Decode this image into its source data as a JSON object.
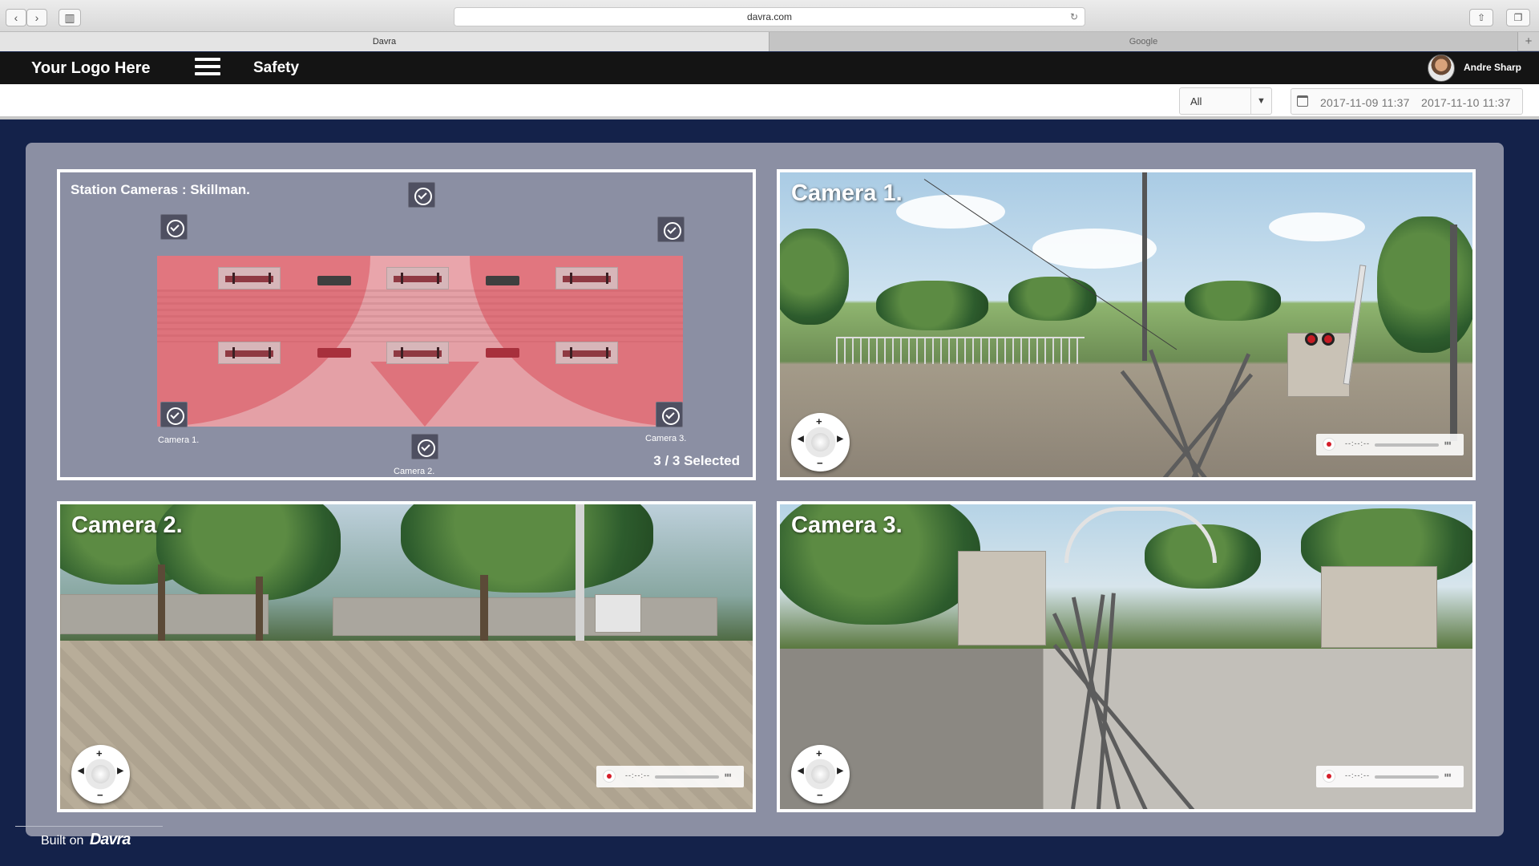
{
  "browser": {
    "url": "davra.com",
    "tabs": [
      {
        "label": "Davra",
        "active": true
      },
      {
        "label": "Google",
        "active": false
      }
    ],
    "back_icon": "chevron-left-icon",
    "forward_icon": "chevron-right-icon",
    "sidebar_icon": "sidebar-icon",
    "reload_icon": "reload-icon",
    "share_icon": "share-icon",
    "window_icon": "window-icon",
    "new_tab_icon": "plus-icon"
  },
  "header": {
    "logo": "Your Logo Here",
    "menu_icon": "hamburger-icon",
    "title": "Safety",
    "user_name": "Andre Sharp",
    "avatar_icon": "user-avatar-icon"
  },
  "filters": {
    "select_value": "All",
    "date_icon": "calendar-icon",
    "date_from": "2017-11-09  11:37",
    "date_to": "2017-11-10  11:37"
  },
  "station": {
    "title": "Station Cameras :  Skillman.",
    "selected": "3 / 3 Selected",
    "cameras": [
      {
        "label": "Camera 1."
      },
      {
        "label": "Camera 2."
      },
      {
        "label": "Camera 3."
      }
    ]
  },
  "camera_tiles": [
    {
      "title": "Camera 1.",
      "time": "--:--:--"
    },
    {
      "title": "Camera 2.",
      "time": "--:--:--"
    },
    {
      "title": "Camera 3.",
      "time": "--:--:--"
    }
  ],
  "footer": {
    "built_on": "Built on",
    "brand": "Davra"
  },
  "colors": {
    "page_background": "#14224a",
    "panel": "#8b8fa3",
    "coverage_red": "#e25460",
    "recording_red": "#d51e2a"
  }
}
